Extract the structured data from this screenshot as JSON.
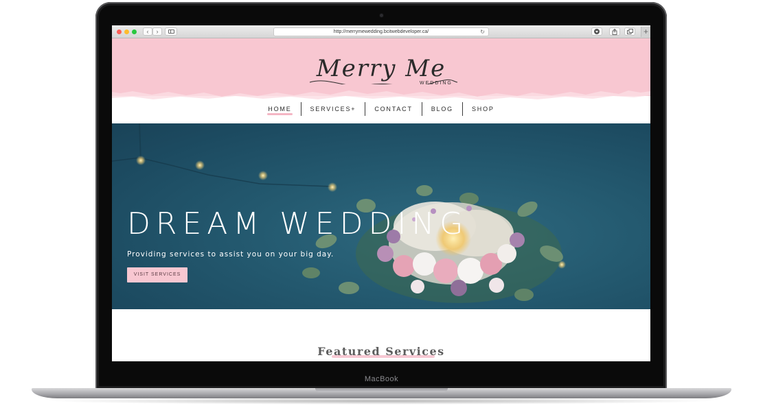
{
  "device": {
    "brand_label": "MacBook"
  },
  "browser": {
    "url": "http://merrymewedding.bcitwebdeveloper.ca/",
    "icons": [
      "back-icon",
      "forward-icon",
      "sidebar-icon",
      "reload-icon",
      "download-icon",
      "share-icon",
      "tabs-icon",
      "new-tab-icon"
    ],
    "new_tab_symbol": "+"
  },
  "site": {
    "logo_script": "Merry Me",
    "logo_sub": "WEDDING",
    "nav": [
      {
        "label": "HOME",
        "active": true
      },
      {
        "label": "SERVICES+",
        "active": false
      },
      {
        "label": "CONTACT",
        "active": false
      },
      {
        "label": "BLOG",
        "active": false
      },
      {
        "label": "SHOP",
        "active": false
      }
    ],
    "hero": {
      "title": "DREAM WEDDING",
      "subtitle": "Providing services to assist you on your big day.",
      "button": "VISIT SERVICES"
    },
    "featured": {
      "title": "Featured Services"
    }
  },
  "colors": {
    "header_pink": "#f8c7d1",
    "accent_pink": "#f4b6c4",
    "hero_blue": "#245a70"
  }
}
